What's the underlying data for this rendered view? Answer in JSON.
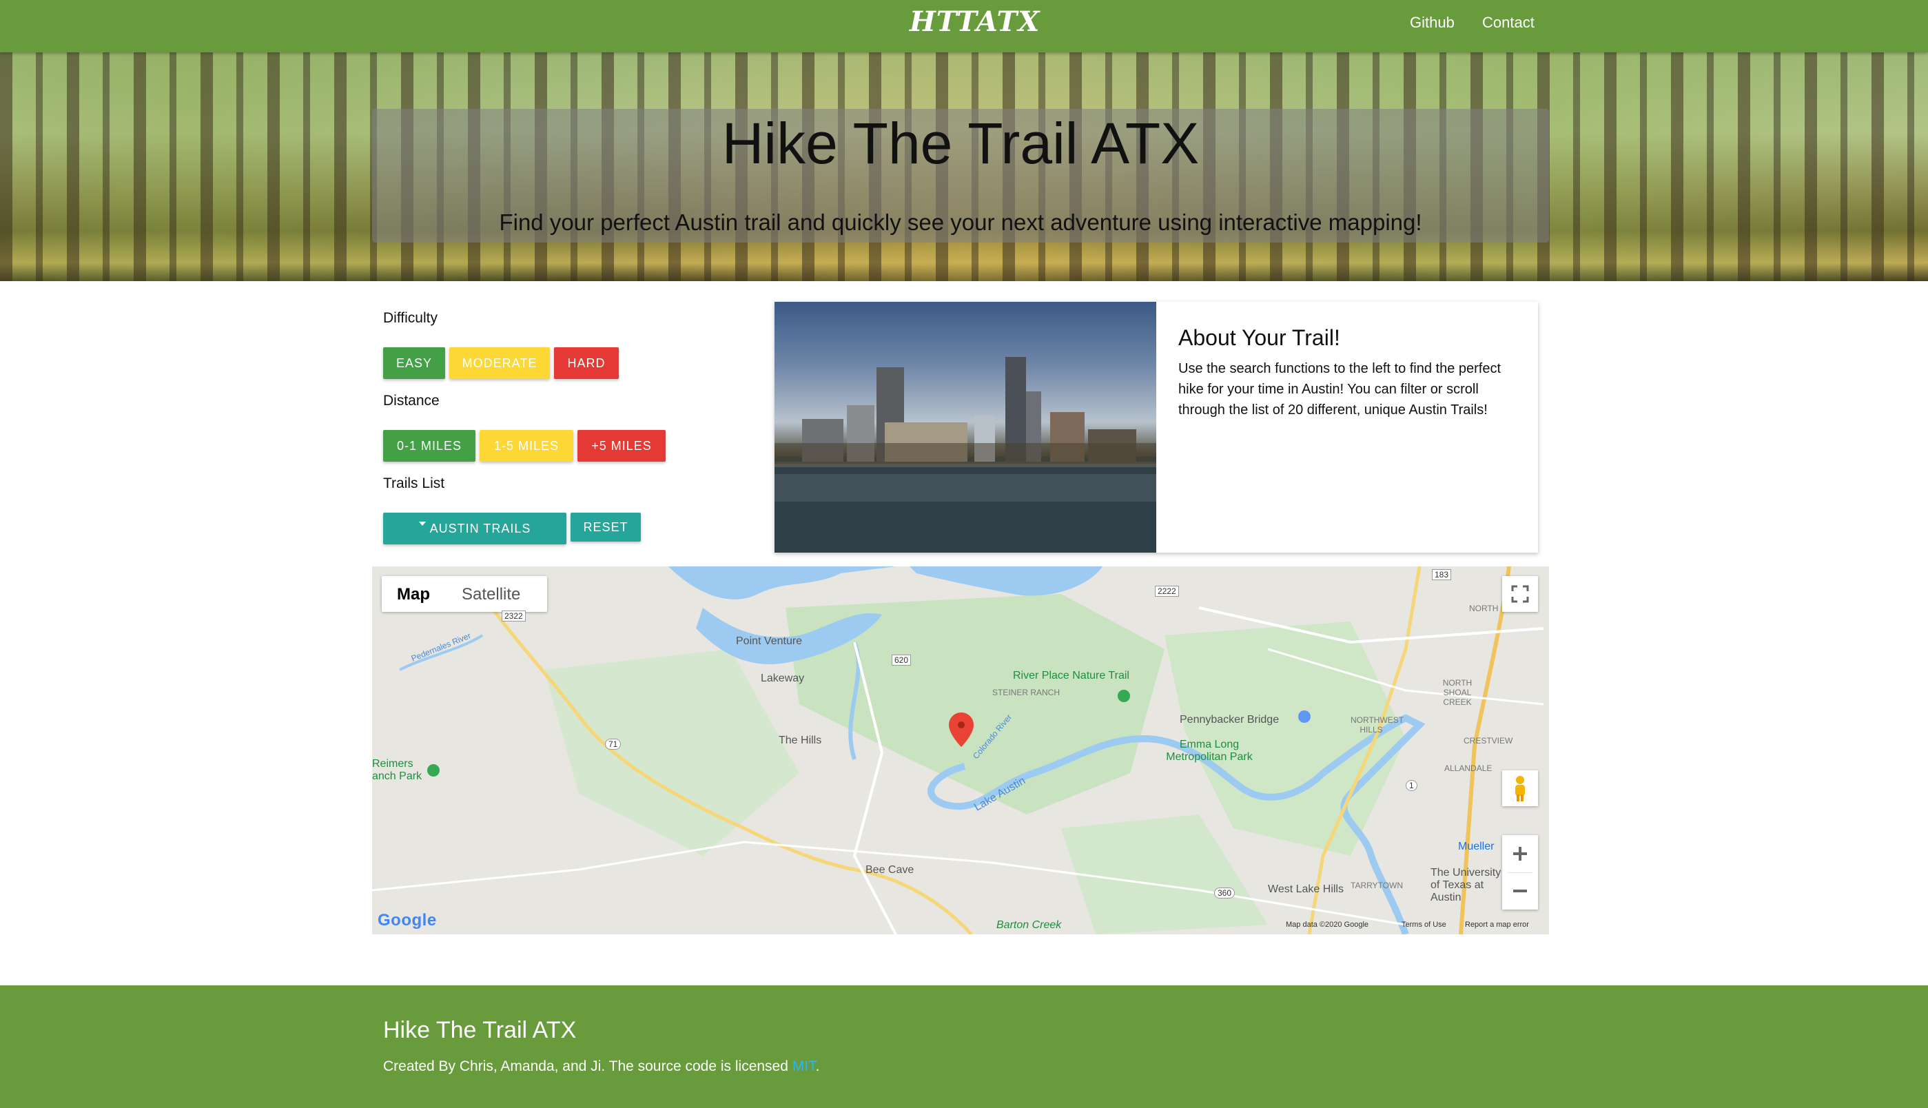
{
  "navbar": {
    "brand": "HTTATX",
    "links": [
      "Github",
      "Contact"
    ]
  },
  "hero": {
    "title": "Hike The Trail ATX",
    "subtitle": "Find your perfect Austin trail and quickly see your next adventure using interactive mapping!"
  },
  "filters": {
    "difficulty_label": "Difficulty",
    "difficulty": [
      "EASY",
      "MODERATE",
      "HARD"
    ],
    "distance_label": "Distance",
    "distance": [
      "0-1 MILES",
      "1-5 MILES",
      "+5 MILES"
    ],
    "trails_label": "Trails List",
    "trails_dropdown": "AUSTIN TRAILS",
    "reset": "RESET"
  },
  "card": {
    "title": "About Your Trail!",
    "text": "Use the search functions to the left to find the perfect hike for your time in Austin! You can filter or scroll through the list of 20 different, unique Austin Trails!"
  },
  "map": {
    "types": [
      "Map",
      "Satellite"
    ],
    "places": [
      "Point Venture",
      "Lakeway",
      "River Place Nature Trail",
      "STEINER RANCH",
      "Pennybacker Bridge",
      "The Hills",
      "Emma Long Metropolitan Park",
      "NORTHWEST HILLS",
      "NORTH SHOAL CREEK",
      "CRESTVIEW",
      "ALLANDALE",
      "Reimers",
      "anch Park",
      "Pedernales River",
      "Colorado River",
      "Lake Austin",
      "Bee Cave",
      "West Lake Hills",
      "TARRYTOWN",
      "Mueller",
      "The University of Texas at Austin",
      "Barton Creek",
      "NORTH"
    ],
    "roads": [
      "71",
      "2322",
      "620",
      "2222",
      "183",
      "360",
      "1"
    ],
    "attribution": [
      "Map data ©2020 Google",
      "Terms of Use",
      "Report a map error"
    ],
    "logo": "Google"
  },
  "footer": {
    "title": "Hike The Trail ATX",
    "text_prefix": "Created By Chris, Amanda, and Ji. The source code is licensed ",
    "link": "MIT",
    "text_suffix": "."
  },
  "colors": {
    "brand_green": "#679b3c",
    "easy": "#43a047",
    "moderate": "#fdd835",
    "hard": "#e53935",
    "teal": "#26a69a",
    "water": "#9ccaf0"
  }
}
